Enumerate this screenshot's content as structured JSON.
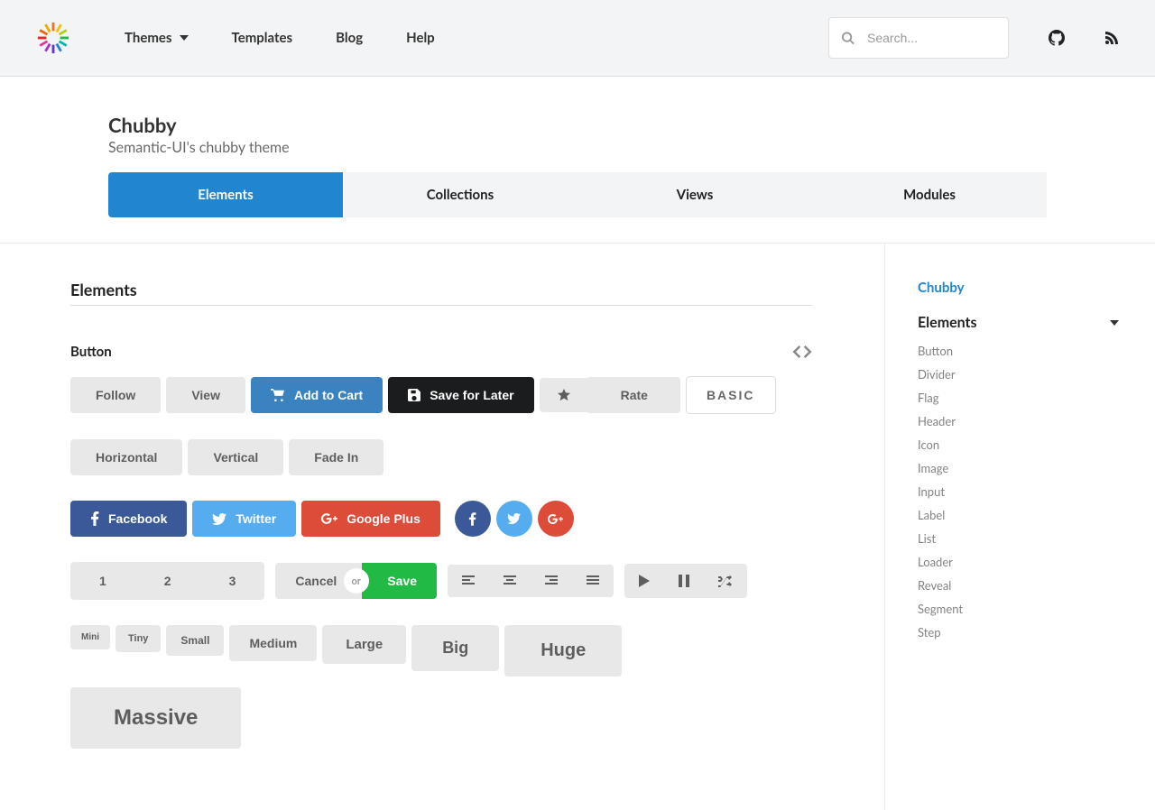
{
  "nav": {
    "themes": "Themes",
    "templates": "Templates",
    "blog": "Blog",
    "help": "Help"
  },
  "search": {
    "placeholder": "Search..."
  },
  "page": {
    "title": "Chubby",
    "subtitle": "Semantic-UI's chubby theme"
  },
  "tabs": {
    "elements": "Elements",
    "collections": "Collections",
    "views": "Views",
    "modules": "Modules"
  },
  "section": {
    "title": "Elements"
  },
  "button": {
    "heading": "Button",
    "follow": "Follow",
    "view": "View",
    "add_to_cart": "Add to Cart",
    "save_for_later": "Save for Later",
    "rate": "Rate",
    "basic": "BASIC",
    "horizontal": "Horizontal",
    "vertical": "Vertical",
    "fade_in": "Fade In",
    "facebook": "Facebook",
    "twitter": "Twitter",
    "google_plus": "Google Plus",
    "one": "1",
    "two": "2",
    "three": "3",
    "cancel": "Cancel",
    "or": "or",
    "save": "Save",
    "mini": "Mini",
    "tiny": "Tiny",
    "small": "Small",
    "medium": "Medium",
    "large": "Large",
    "big": "Big",
    "huge": "Huge",
    "massive": "Massive"
  },
  "sidebar": {
    "top": "Chubby",
    "heading": "Elements",
    "items": [
      "Button",
      "Divider",
      "Flag",
      "Header",
      "Icon",
      "Image",
      "Input",
      "Label",
      "List",
      "Loader",
      "Reveal",
      "Segment",
      "Step"
    ]
  }
}
